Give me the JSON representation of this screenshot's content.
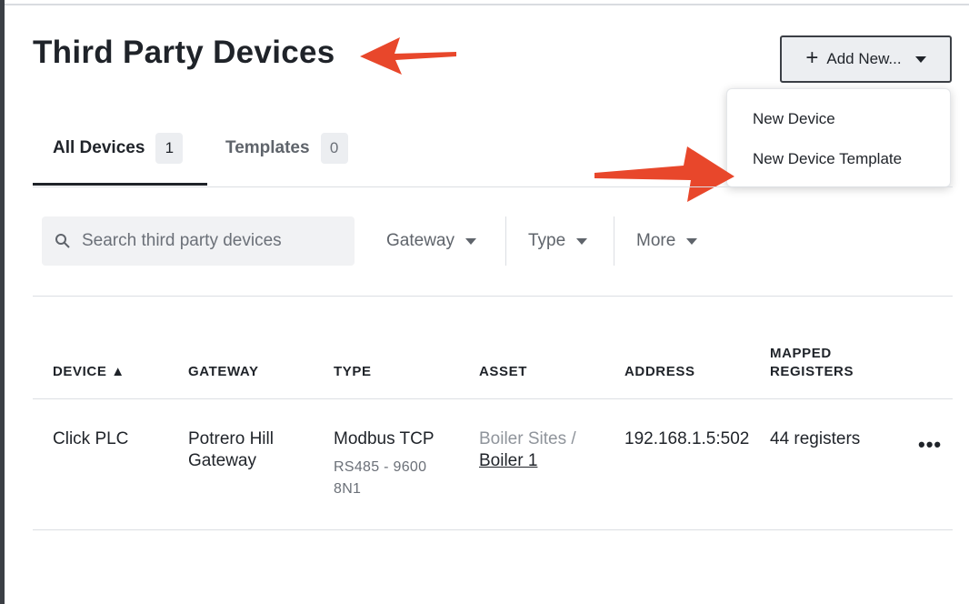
{
  "page": {
    "title": "Third Party Devices"
  },
  "toolbar": {
    "add_label": "Add New...",
    "dropdown_items": [
      "New Device",
      "New Device Template"
    ]
  },
  "tabs": [
    {
      "label": "All Devices",
      "count": "1",
      "active": true
    },
    {
      "label": "Templates",
      "count": "0",
      "active": false
    }
  ],
  "search": {
    "placeholder": "Search third party devices"
  },
  "filters": [
    "Gateway",
    "Type",
    "More"
  ],
  "table": {
    "columns": [
      "DEVICE ▲",
      "GATEWAY",
      "TYPE",
      "ASSET",
      "ADDRESS",
      "MAPPED",
      "REGISTERS"
    ],
    "rows": [
      {
        "device": "Click PLC",
        "gateway_line1": "Potrero Hill",
        "gateway_line2": "Gateway",
        "type": "Modbus TCP",
        "type_detail_line1": "RS485 - 9600",
        "type_detail_line2": "8N1",
        "asset_parent": "Boiler Sites /",
        "asset_name": "Boiler 1",
        "address": "192.168.1.5:502",
        "registers": "44 registers"
      }
    ]
  },
  "colors": {
    "annotation_arrow": "#e8472b",
    "text": "#1f2329",
    "muted": "#6b7078"
  }
}
